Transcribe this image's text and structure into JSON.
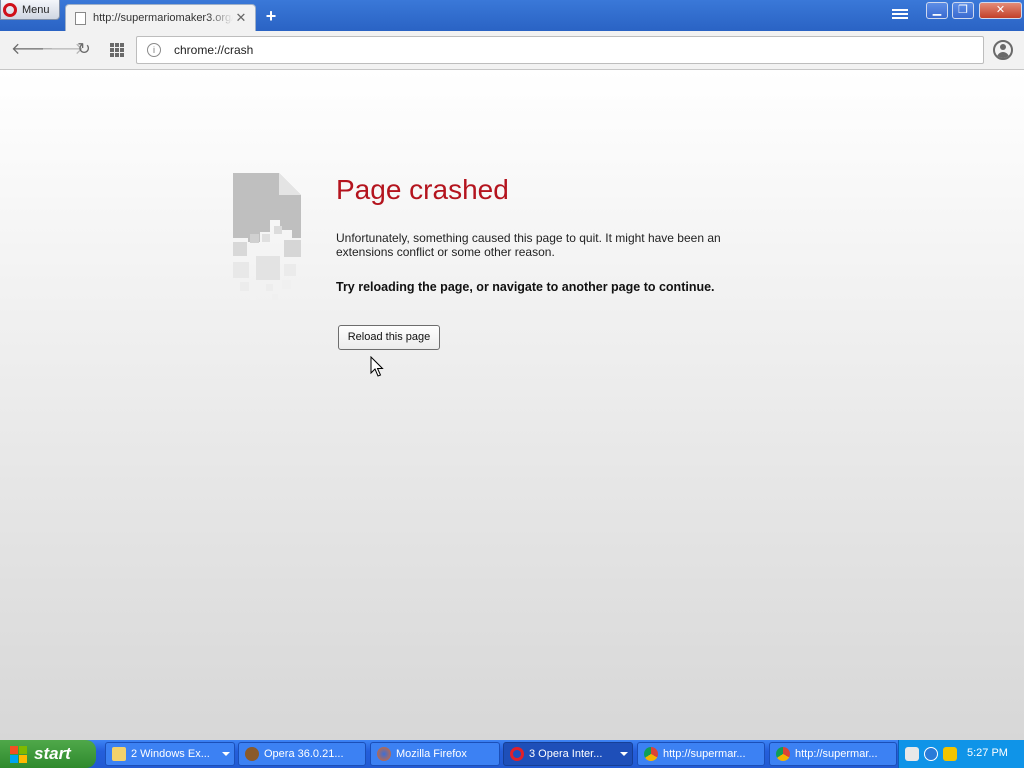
{
  "browser": {
    "menu_label": "Menu",
    "tab_title": "http://supermariomaker3.org/",
    "url": "chrome://crash",
    "new_tab_symbol": "+",
    "tab_close_symbol": "✕"
  },
  "page": {
    "title": "Page crashed",
    "message": "Unfortunately, something caused this page to quit. It might have been an extensions conflict or some other reason.",
    "hint": "Try reloading the page, or navigate to another page to continue.",
    "reload_button": "Reload this page"
  },
  "taskbar": {
    "start_label": "start",
    "items": [
      {
        "label": "2 Windows Ex...",
        "icon": "folder-icon"
      },
      {
        "label": "Opera 36.0.21...",
        "icon": "opera-installer-icon"
      },
      {
        "label": "Mozilla Firefox",
        "icon": "firefox-icon"
      },
      {
        "label": "3 Opera Inter...",
        "icon": "opera-icon"
      },
      {
        "label": "http://supermar...",
        "icon": "chrome-icon"
      },
      {
        "label": "http://supermar...",
        "icon": "chrome-icon"
      }
    ],
    "clock": "5:27 PM"
  },
  "colors": {
    "title_red": "#b4141e",
    "taskbar_blue": "#245edb",
    "start_green": "#2f8a2d"
  }
}
